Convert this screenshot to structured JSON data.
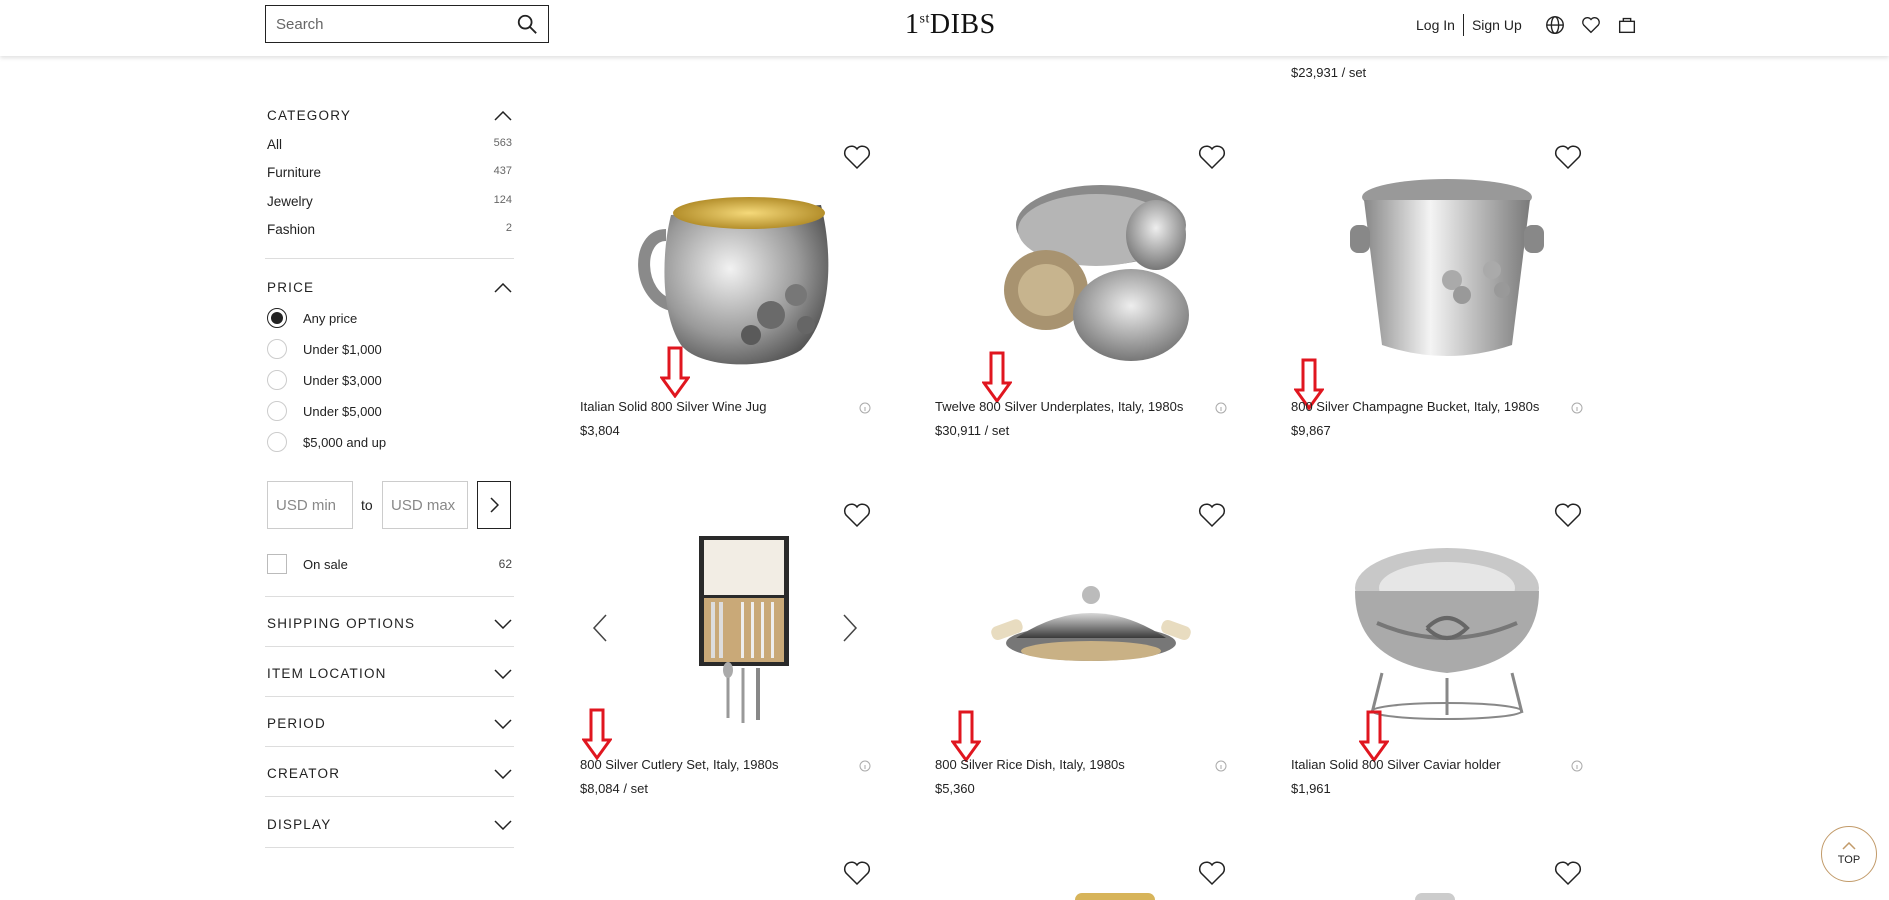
{
  "header": {
    "search_placeholder": "Search",
    "logo": "1stDIBS",
    "login": "Log In",
    "signup": "Sign Up"
  },
  "sidebar": {
    "category": {
      "title": "CATEGORY",
      "items": [
        {
          "label": "All",
          "count": "563"
        },
        {
          "label": "Furniture",
          "count": "437"
        },
        {
          "label": "Jewelry",
          "count": "124"
        },
        {
          "label": "Fashion",
          "count": "2"
        }
      ]
    },
    "price": {
      "title": "PRICE",
      "options": [
        {
          "label": "Any price",
          "checked": true
        },
        {
          "label": "Under $1,000",
          "checked": false
        },
        {
          "label": "Under $3,000",
          "checked": false
        },
        {
          "label": "Under $5,000",
          "checked": false
        },
        {
          "label": "$5,000 and up",
          "checked": false
        }
      ],
      "min_placeholder": "USD min",
      "to_label": "to",
      "max_placeholder": "USD max",
      "on_sale_label": "On sale",
      "on_sale_count": "62"
    },
    "sections": [
      "SHIPPING OPTIONS",
      "ITEM LOCATION",
      "PERIOD",
      "CREATOR",
      "DISPLAY"
    ]
  },
  "partial_top": {
    "col3_price": "$23,931 / set"
  },
  "products": [
    {
      "title": "Italian Solid 800 Silver Wine Jug",
      "price": "$3,804"
    },
    {
      "title": "Twelve 800 Silver Underplates, Italy, 1980s",
      "price": "$30,911 / set"
    },
    {
      "title": "800 Silver Champagne Bucket, Italy, 1980s",
      "price": "$9,867"
    },
    {
      "title": "800 Silver Cutlery Set, Italy, 1980s",
      "price": "$8,084 / set"
    },
    {
      "title": "800 Silver Rice Dish, Italy, 1980s",
      "price": "$5,360"
    },
    {
      "title": "Italian Solid 800 Silver Caviar holder",
      "price": "$1,961"
    }
  ],
  "top_button": "TOP",
  "colors": {
    "accent_red": "#e0161f",
    "top_border": "#c29b6a"
  }
}
